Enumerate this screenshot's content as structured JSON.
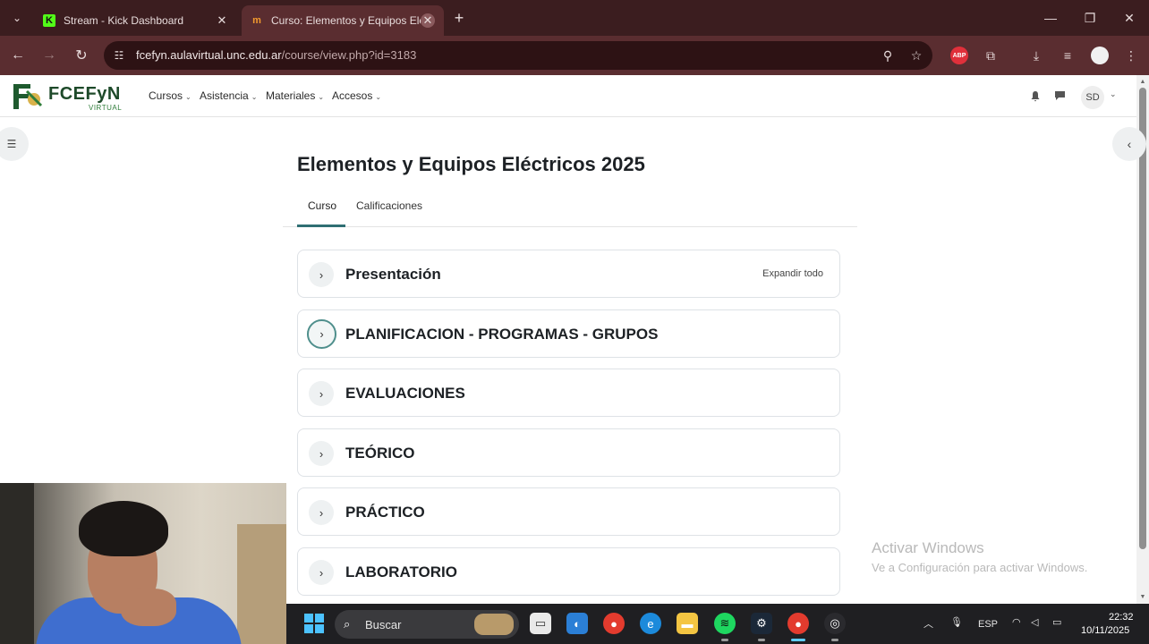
{
  "browser": {
    "tabs": [
      {
        "title": "Stream - Kick Dashboard",
        "favicon": "kick-icon",
        "active": false
      },
      {
        "title": "Curso: Elementos y Equipos Elé",
        "favicon": "moodle-icon",
        "active": true
      }
    ],
    "url_host": "fcefyn.aulavirtual.unc.edu.ar",
    "url_path": "/course/view.php?id=3183",
    "abp_label": "ABP"
  },
  "site": {
    "logo_text": "FCEFyN",
    "logo_sub": "VIRTUAL",
    "menu": [
      "Cursos",
      "Asistencia",
      "Materiales",
      "Accesos"
    ],
    "avatar_initials": "SD"
  },
  "course": {
    "title": "Elementos y Equipos Eléctricos 2025",
    "tabs": [
      "Curso",
      "Calificaciones"
    ],
    "active_tab": "Curso",
    "expand_all": "Expandir todo",
    "sections": [
      "Presentación",
      "PLANIFICACION - PROGRAMAS - GRUPOS",
      "EVALUACIONES",
      "TEÓRICO",
      "PRÁCTICO",
      "LABORATORIO"
    ]
  },
  "watermark": {
    "title": "Activar Windows",
    "subtitle": "Ve a Configuración para activar Windows."
  },
  "taskbar": {
    "search_label": "Buscar",
    "language": "ESP",
    "time": "22:32",
    "date": "10/11/2025"
  },
  "colors": {
    "tab_strip": "#3b1d1f",
    "toolbar": "#5a2d30",
    "accent": "#2f6f73",
    "taskbar": "#1f1f22"
  }
}
